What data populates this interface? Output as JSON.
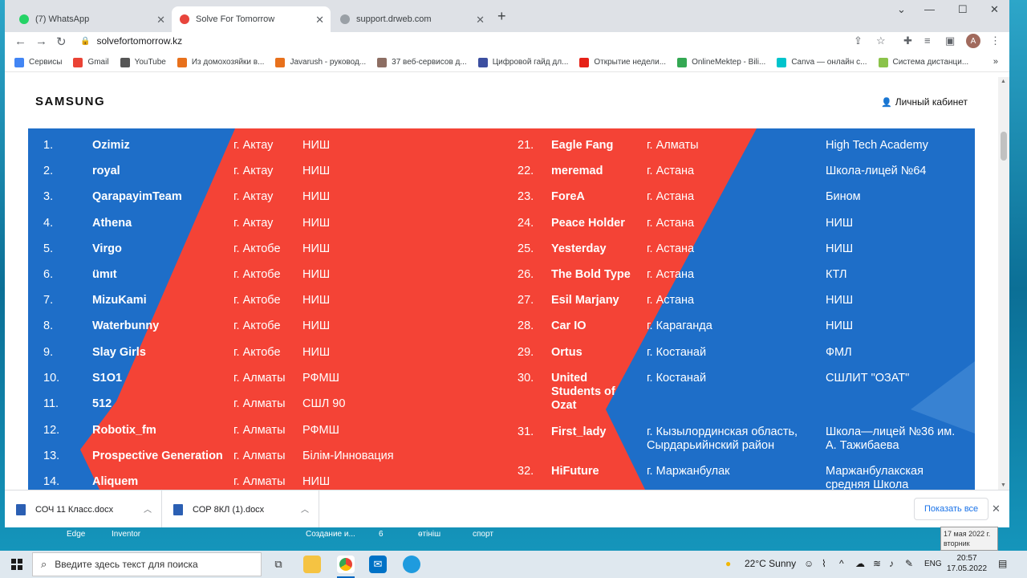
{
  "browser": {
    "tabs": [
      {
        "title": "(7) WhatsApp",
        "color": "#25d366"
      },
      {
        "title": "Solve For Tomorrow",
        "color": "#e8453c"
      },
      {
        "title": "support.drweb.com",
        "color": "#9aa0a6"
      }
    ],
    "url": "solvefortomorrow.kz",
    "avatar_letter": "A",
    "bookmarks": [
      {
        "label": "Сервисы",
        "color": "#4285f4"
      },
      {
        "label": "Gmail",
        "color": "#ea4335"
      },
      {
        "label": "YouTube",
        "color": "#555555"
      },
      {
        "label": "Из домохозяйки в...",
        "color": "#e8711c"
      },
      {
        "label": "Javarush - руковод...",
        "color": "#e8711c"
      },
      {
        "label": "37 веб-сервисов д...",
        "color": "#8d6e63"
      },
      {
        "label": "Цифровой гайд дл...",
        "color": "#3c4fa0"
      },
      {
        "label": "Открытие недели...",
        "color": "#e62117"
      },
      {
        "label": "OnlineMektep - Bili...",
        "color": "#34a853"
      },
      {
        "label": "Canva — онлайн с...",
        "color": "#00c4cc"
      },
      {
        "label": "Система дистанци...",
        "color": "#8bc34a"
      }
    ]
  },
  "page": {
    "logo": "SAMSUNG",
    "cabinet": "Личный кабинет",
    "left_rows": [
      {
        "n": "1.",
        "team": "Ozimiz",
        "city": "г. Актау",
        "school": "НИШ"
      },
      {
        "n": "2.",
        "team": "royal",
        "city": "г. Актау",
        "school": "НИШ"
      },
      {
        "n": "3.",
        "team": "QarapayimTeam",
        "city": "г. Актау",
        "school": "НИШ"
      },
      {
        "n": "4.",
        "team": "Athena",
        "city": "г. Актау",
        "school": "НИШ"
      },
      {
        "n": "5.",
        "team": "Virgo",
        "city": "г. Актобе",
        "school": "НИШ"
      },
      {
        "n": "6.",
        "team": "ümıt",
        "city": "г. Актобе",
        "school": "НИШ"
      },
      {
        "n": "7.",
        "team": "MizuKami",
        "city": "г. Актобе",
        "school": "НИШ"
      },
      {
        "n": "8.",
        "team": "Waterbunny",
        "city": "г. Актобе",
        "school": "НИШ"
      },
      {
        "n": "9.",
        "team": "Slay Girls",
        "city": "г. Актобе",
        "school": "НИШ"
      },
      {
        "n": "10.",
        "team": "S1O1",
        "city": "г. Алматы",
        "school": "РФМШ"
      },
      {
        "n": "11.",
        "team": "512",
        "city": "г. Алматы",
        "school": "СШЛ 90"
      },
      {
        "n": "12.",
        "team": "Robotix_fm",
        "city": "г. Алматы",
        "school": "РФМШ"
      },
      {
        "n": "13.",
        "team": "Prospective Generation",
        "city": "г. Алматы",
        "school": "Білім-Инновация"
      },
      {
        "n": "14.",
        "team": "Aliquem",
        "city": "г. Алматы",
        "school": "НИШ"
      }
    ],
    "right_rows": [
      {
        "n": "21.",
        "team": "Eagle Fang",
        "city": "г. Алматы",
        "school": "High Tech Academy"
      },
      {
        "n": "22.",
        "team": "meremad",
        "city": "г. Астана",
        "school": "Школа-лицей №64"
      },
      {
        "n": "23.",
        "team": "ForeA",
        "city": "г. Астана",
        "school": "Бином"
      },
      {
        "n": "24.",
        "team": "Peace Holder",
        "city": "г. Астана",
        "school": "НИШ"
      },
      {
        "n": "25.",
        "team": "Yesterday",
        "city": "г. Астана",
        "school": "НИШ"
      },
      {
        "n": "26.",
        "team": "The Bold Type",
        "city": "г. Астана",
        "school": "КТЛ"
      },
      {
        "n": "27.",
        "team": "Esil Marjany",
        "city": "г. Астана",
        "school": "НИШ"
      },
      {
        "n": "28.",
        "team": "Car IO",
        "city": "г. Караганда",
        "school": "НИШ"
      },
      {
        "n": "29.",
        "team": "Ortus",
        "city": "г. Костанай",
        "school": "ФМЛ"
      },
      {
        "n": "30.",
        "team": "United Students of Ozat",
        "city": "г. Костанай",
        "school": "СШЛИТ \"ОЗАТ\""
      },
      {
        "n": "31.",
        "team": "First_lady",
        "city": "г. Кызылординская область, Сырдарьийнский район",
        "school": "Школа—лицей №36 им. А. Тажибаева"
      },
      {
        "n": "32.",
        "team": "HiFuture",
        "city": "г. Маржанбулак",
        "school": "Маржанбулакская средняя Школа"
      }
    ]
  },
  "downloads": {
    "items": [
      "СОЧ 11 Класс.docx",
      "СОР 8КЛ (1).docx"
    ],
    "show_all": "Показать все"
  },
  "desktop": {
    "labels": [
      "Edge",
      "Inventor",
      "Создание и...",
      "6",
      "өтініш",
      "спорт"
    ],
    "tooltip_line1": "17 мая 2022 г.",
    "tooltip_line2": "вторник"
  },
  "taskbar": {
    "search_placeholder": "Введите здесь текст для поиска",
    "weather": "22°C  Sunny",
    "lang": "ENG",
    "time": "20:57",
    "date": "17.05.2022"
  }
}
